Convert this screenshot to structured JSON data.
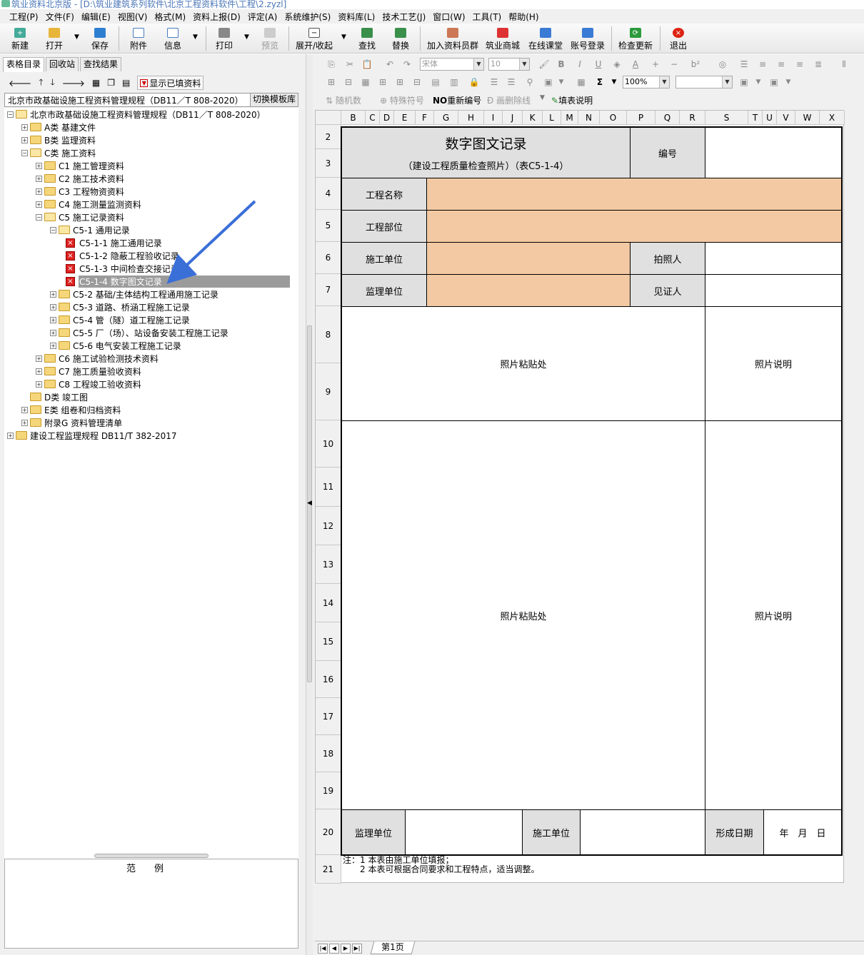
{
  "window": {
    "title": "筑业资料北京版 - [D:\\筑业建筑系列软件\\北京工程资料软件\\工程\\2.zyzl]"
  },
  "menu": [
    "工程(P)",
    "文件(F)",
    "编辑(E)",
    "视图(V)",
    "格式(M)",
    "资料上报(D)",
    "评定(A)",
    "系统维护(S)",
    "资料库(L)",
    "技术工艺(J)",
    "窗口(W)",
    "工具(T)",
    "帮助(H)"
  ],
  "toolbar": {
    "new": "新建",
    "open": "打开",
    "save": "保存",
    "attach": "附件",
    "info": "信息",
    "print": "打印",
    "preview": "预览",
    "expand": "展开/收起",
    "find": "查找",
    "replace": "替换",
    "join": "加入资料员群",
    "mall": "筑业商城",
    "course": "在线课堂",
    "login": "账号登录",
    "update": "检查更新",
    "exit": "退出"
  },
  "left": {
    "tabs": [
      "表格目录",
      "回收站",
      "查找结果"
    ],
    "show_filled": "显示已填资料",
    "spec": "北京市政基础设施工程资料管理规程（DB11／T 808-2020）",
    "switch_btn": "切换模板库",
    "tree": [
      {
        "label": "北京市政基础设施工程资料管理规程（DB11／T 808-2020）",
        "level": 0,
        "type": "folder",
        "open": true
      },
      {
        "label": "A类 基建文件",
        "level": 1,
        "type": "folder",
        "open": false
      },
      {
        "label": "B类 监理资料",
        "level": 1,
        "type": "folder",
        "open": false
      },
      {
        "label": "C类 施工资料",
        "level": 1,
        "type": "folder",
        "open": true
      },
      {
        "label": "C1 施工管理资料",
        "level": 2,
        "type": "folder",
        "open": false
      },
      {
        "label": "C2 施工技术资料",
        "level": 2,
        "type": "folder",
        "open": false
      },
      {
        "label": "C3 工程物资资料",
        "level": 2,
        "type": "folder",
        "open": false
      },
      {
        "label": "C4 施工测量监测资料",
        "level": 2,
        "type": "folder",
        "open": false
      },
      {
        "label": "C5 施工记录资料",
        "level": 2,
        "type": "folder",
        "open": true
      },
      {
        "label": "C5-1 通用记录",
        "level": 3,
        "type": "folder",
        "open": true
      },
      {
        "label": "C5-1-1 施工通用记录",
        "level": 4,
        "type": "doc"
      },
      {
        "label": "C5-1-2 隐蔽工程验收记录",
        "level": 4,
        "type": "doc"
      },
      {
        "label": "C5-1-3 中间检查交接记录",
        "level": 4,
        "type": "doc"
      },
      {
        "label": "C5-1-4 数字图文记录",
        "level": 4,
        "type": "doc",
        "selected": true
      },
      {
        "label": "C5-2 基础/主体结构工程通用施工记录",
        "level": 3,
        "type": "folder",
        "open": false
      },
      {
        "label": "C5-3 道路、桥涵工程施工记录",
        "level": 3,
        "type": "folder",
        "open": false
      },
      {
        "label": "C5-4 管（隧）道工程施工记录",
        "level": 3,
        "type": "folder",
        "open": false
      },
      {
        "label": "C5-5 厂（场）、站设备安装工程施工记录",
        "level": 3,
        "type": "folder",
        "open": false
      },
      {
        "label": "C5-6 电气安装工程施工记录",
        "level": 3,
        "type": "folder",
        "open": false
      },
      {
        "label": "C6 施工试验检测技术资料",
        "level": 2,
        "type": "folder",
        "open": false
      },
      {
        "label": "C7 施工质量验收资料",
        "level": 2,
        "type": "folder",
        "open": false
      },
      {
        "label": "C8 工程竣工验收资料",
        "level": 2,
        "type": "folder",
        "open": false
      },
      {
        "label": "D类 竣工图",
        "level": 1,
        "type": "folder",
        "nochild": true
      },
      {
        "label": "E类 组卷和归档资料",
        "level": 1,
        "type": "folder",
        "open": false
      },
      {
        "label": "附录G 资料管理清单",
        "level": 1,
        "type": "folder",
        "open": false
      },
      {
        "label": "建设工程监理规程 DB11/T 382-2017",
        "level": 0,
        "type": "folder",
        "open": false
      }
    ],
    "legend": "范　　例"
  },
  "format": {
    "font": "宋体",
    "size": "10",
    "zoom": "100%",
    "sigma": "Σ",
    "random": "随机数",
    "special": "特殊符号",
    "renumber": "重新编号",
    "strike": "画删除线",
    "fill_help": "填表说明",
    "no_glyph": "NO"
  },
  "sheet": {
    "columns": [
      "B",
      "C",
      "D",
      "E",
      "F",
      "G",
      "H",
      "I",
      "J",
      "K",
      "L",
      "M",
      "N",
      "O",
      "P",
      "Q",
      "R",
      "S",
      "T",
      "U",
      "V",
      "W",
      "X"
    ],
    "rows": [
      "2",
      "3",
      "4",
      "5",
      "6",
      "7",
      "8",
      "9",
      "10",
      "11",
      "12",
      "13",
      "14",
      "15",
      "16",
      "17",
      "18",
      "19",
      "20",
      "21"
    ],
    "title": "数字图文记录",
    "subtitle": "（建设工程质量检查照片）（表C5-1-4）",
    "number_label": "编号",
    "project_name": "工程名称",
    "project_part": "工程部位",
    "construction_unit": "施工单位",
    "photographer": "拍照人",
    "supervision_unit": "监理单位",
    "witness": "见证人",
    "photo_area_1": "照片粘贴处",
    "photo_desc_1": "照片说明",
    "photo_area_2": "照片粘贴处",
    "photo_desc_2": "照片说明",
    "footer_supervision": "监理单位",
    "footer_construction": "施工单位",
    "form_date": "形成日期",
    "date_value": "年　月　日",
    "note1": "注：1 本表由施工单位填报；",
    "note2": "　　2 本表可根据合同要求和工程特点，适当调整。"
  },
  "sheet_tab": "第1页",
  "colors": {
    "peach": "#f2c9a2",
    "grey": "#e0e0e0",
    "arrow": "#3a6fd8"
  }
}
